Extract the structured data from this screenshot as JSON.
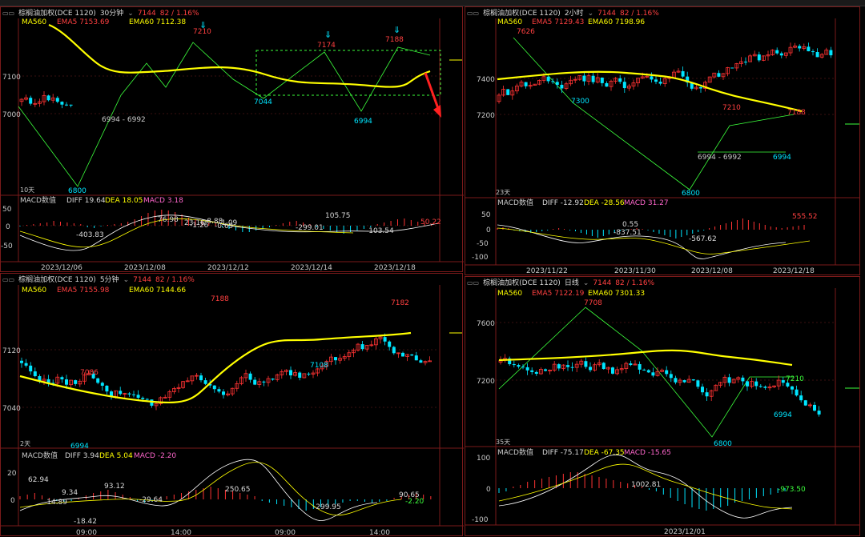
{
  "colors": {
    "up": "#ff3333",
    "down": "#00e5ff",
    "ma": "#ffff00",
    "frame": "#7a1a1a",
    "grid": "#3a0f0f"
  },
  "panels": [
    {
      "id": "p30",
      "symbol": "棕榈油加权(DCE 1120)",
      "period": "30分钟",
      "price": "7144",
      "change": "82 / 1.16%",
      "ma": {
        "ma560": "MA560",
        "ema5": "EMA5 7153.69",
        "ema60": "EMA60 7112.38"
      },
      "macd": {
        "name": "MACD数值",
        "diff": "DIFF 19.64",
        "dea": "DEA 18.05",
        "macd": "MACD 3.18"
      },
      "yticks": [
        "7100",
        "7000"
      ],
      "macd_yticks": [
        "50",
        "0",
        "-50"
      ],
      "xlabels": [
        "2023/12/06",
        "2023/12/08",
        "2023/12/12",
        "2023/12/14",
        "2023/12/18"
      ],
      "annotations": [
        "7210",
        "7174",
        "7188",
        "7044",
        "6994",
        "6800",
        "6994 - 6992",
        "10天"
      ],
      "macd_labels": [
        "-403.83",
        "76.98",
        "23.16",
        "-1.26",
        "-8.88",
        "-1.09",
        "-0.69",
        "-299.01",
        "105.75",
        "-103.54",
        "50.22"
      ]
    },
    {
      "id": "p2h",
      "symbol": "棕榈油加权(DCE 1120)",
      "period": "2小时",
      "price": "7144",
      "change": "82 / 1.16%",
      "ma": {
        "ma560": "MA560",
        "ema5": "EMA5 7129.43",
        "ema60": "EMA60 7198.96"
      },
      "macd": {
        "name": "MACD数值",
        "diff": "DIFF -12.92",
        "dea": "DEA -28.56",
        "macd": "MACD 31.27"
      },
      "yticks": [
        "7400",
        "7200"
      ],
      "macd_yticks": [
        "50",
        "0",
        "-50",
        "-100"
      ],
      "xlabels": [
        "2023/11/22",
        "2023/11/30",
        "2023/12/08",
        "2023/12/18"
      ],
      "annotations": [
        "7626",
        "7300",
        "7210",
        "7188",
        "6994 - 6992",
        "6994",
        "6800",
        "23天"
      ],
      "macd_labels": [
        "0.55",
        "-837.51",
        "-567.62",
        "555.52"
      ]
    },
    {
      "id": "p5m",
      "symbol": "棕榈油加权(DCE 1120)",
      "period": "5分钟",
      "price": "7144",
      "change": "82 / 1.16%",
      "ma": {
        "ma560": "MA560",
        "ema5": "EMA5 7155.98",
        "ema60": "EMA60 7144.66"
      },
      "macd": {
        "name": "MACD数值",
        "diff": "DIFF 3.94",
        "dea": "DEA 5.04",
        "macd": "MACD -2.20"
      },
      "yticks": [
        "7120",
        "7040"
      ],
      "macd_yticks": [
        "20",
        "0"
      ],
      "xlabels": [
        "09:00",
        "14:00",
        "09:00",
        "14:00"
      ],
      "annotations": [
        "7188",
        "7182",
        "7086",
        "7108",
        "6994",
        "2天"
      ],
      "macd_labels": [
        "62.94",
        "9.34",
        "-14.89",
        "93.12",
        "-18.42",
        "-29.64",
        "250.65",
        "-299.95",
        "90.65",
        "-2.20"
      ]
    },
    {
      "id": "pd",
      "symbol": "棕榈油加权(DCE 1120)",
      "period": "日线",
      "price": "7144",
      "change": "82 / 1.16%",
      "ma": {
        "ma560": "MA560",
        "ema5": "EMA5 7122.19",
        "ema60": "EMA60 7301.33"
      },
      "macd": {
        "name": "MACD数值",
        "diff": "DIFF -75.17",
        "dea": "DEA -67.35",
        "macd": "MACD -15.65"
      },
      "yticks": [
        "7600",
        "7200"
      ],
      "macd_yticks": [
        "100",
        "0",
        "-100"
      ],
      "xlabels": [
        "2023/12/01"
      ],
      "annotations": [
        "7708",
        "7210",
        "6994",
        "6800",
        "35天"
      ],
      "macd_labels": [
        "1002.81",
        "-973.50"
      ]
    }
  ]
}
